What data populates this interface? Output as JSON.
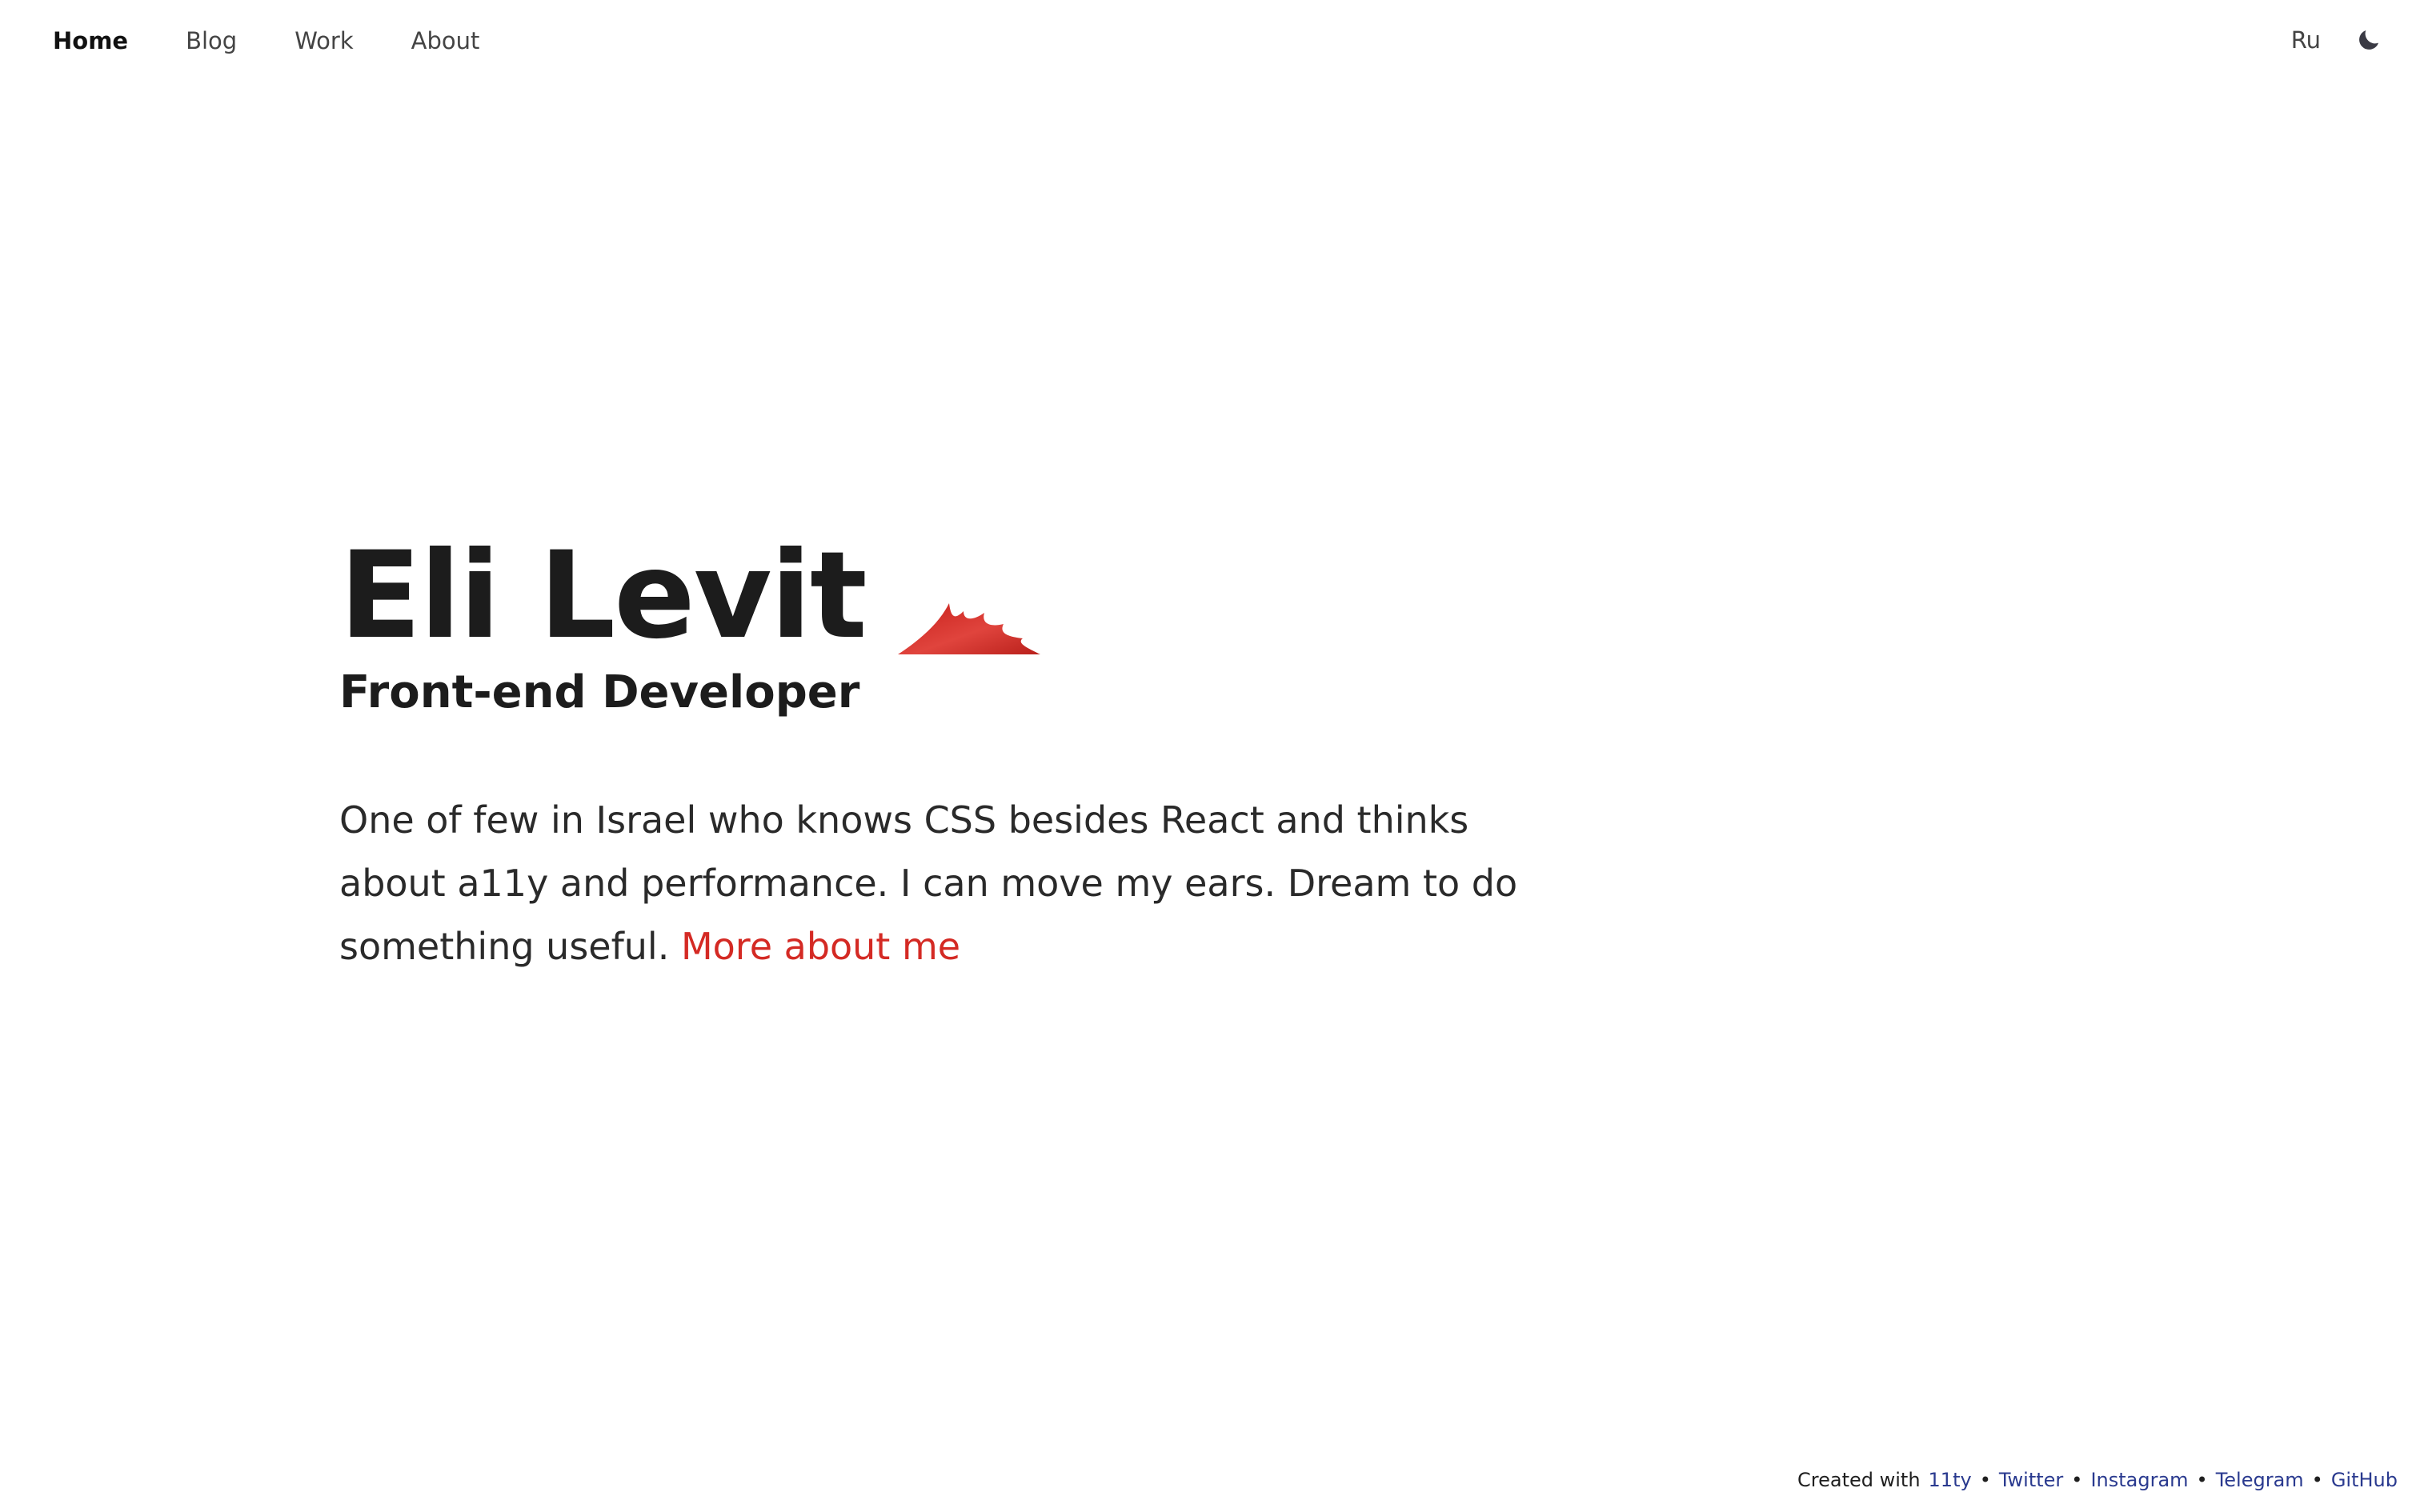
{
  "nav": {
    "items": [
      {
        "label": "Home",
        "active": true
      },
      {
        "label": "Blog",
        "active": false
      },
      {
        "label": "Work",
        "active": false
      },
      {
        "label": "About",
        "active": false
      }
    ],
    "language_label": "Ru",
    "theme_toggle_icon": "moon-icon"
  },
  "hero": {
    "name": "Eli Levit",
    "role": "Front-end Developer",
    "bio": "One of few in Israel who knows CSS besides React and thinks about a11y and performance. I can move my ears. Dream to do something useful.",
    "bio_link": "More about me",
    "decoration_icon": "flame-icon"
  },
  "footer": {
    "prefix": "Created with",
    "links": [
      "11ty",
      "Twitter",
      "Instagram",
      "Telegram",
      "GitHub"
    ],
    "separator": "•"
  },
  "colors": {
    "accent": "#d42a24",
    "footer_link": "#2a3a8f",
    "text": "#1f1f1f",
    "background": "#ffffff"
  }
}
